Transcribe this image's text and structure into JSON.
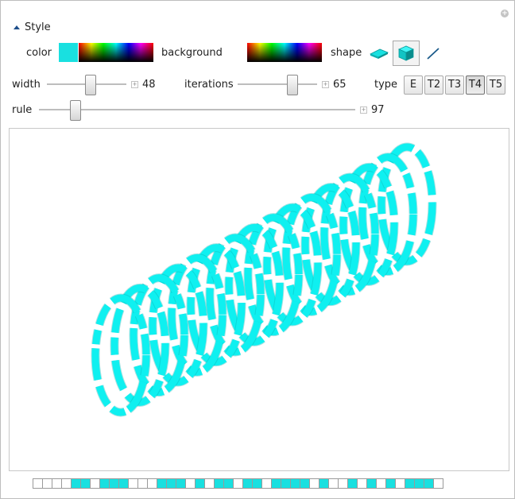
{
  "section": {
    "title": "Style",
    "caret_icon": "caret-up-icon"
  },
  "corner": {
    "icon": "plus-circle-icon",
    "glyph": "+"
  },
  "style": {
    "color_label": "color",
    "color_value": "#19e0e0",
    "background_label": "background",
    "shape_label": "shape",
    "shapes": [
      {
        "name": "flat-tile-icon",
        "selected": false
      },
      {
        "name": "cube-icon",
        "selected": true
      },
      {
        "name": "line-icon",
        "selected": false
      }
    ]
  },
  "controls": {
    "width": {
      "label": "width",
      "value": "48",
      "fraction": 0.55
    },
    "iterations": {
      "label": "iterations",
      "value": "65",
      "fraction": 0.71
    },
    "rule": {
      "label": "rule",
      "value": "97",
      "fraction": 0.1
    },
    "increment_glyph": "+"
  },
  "type": {
    "label": "type",
    "options": [
      "E",
      "T2",
      "T3",
      "T4",
      "T5"
    ],
    "selected": "T4"
  },
  "plot": {
    "shape": "cylinder",
    "fill": "#0ff0f0",
    "stroke": "#0aa8a8"
  },
  "rule_bits": [
    0,
    0,
    0,
    0,
    1,
    1,
    0,
    1,
    1,
    1,
    0,
    0,
    0,
    1,
    1,
    1,
    0,
    1,
    0,
    1,
    1,
    0,
    1,
    1,
    0,
    1,
    1,
    1,
    1,
    0,
    1,
    0,
    0,
    1,
    0,
    1,
    0,
    1,
    0,
    1,
    1,
    1,
    0
  ],
  "colors": {
    "accent": "#19e0e0",
    "cell_on": "#19e0e0",
    "cell_off": "#ffffff"
  }
}
